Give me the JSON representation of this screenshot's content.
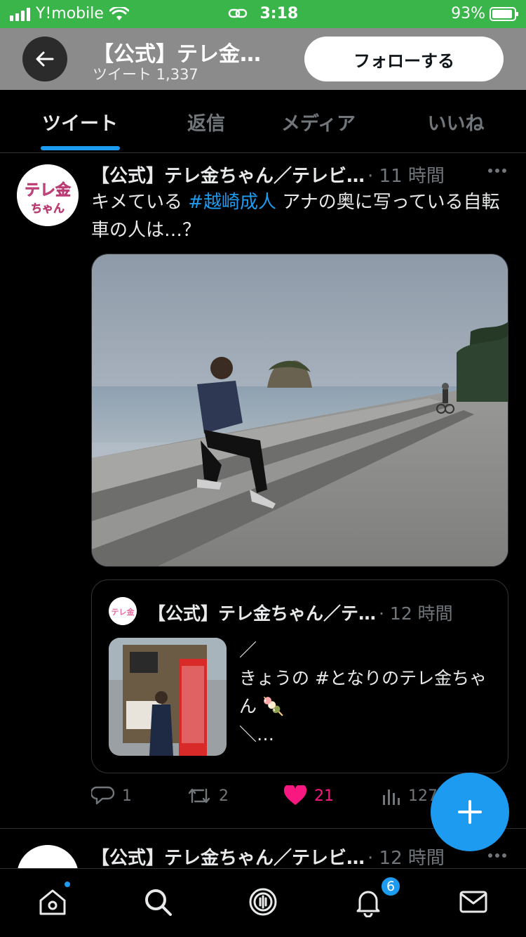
{
  "status_bar": {
    "carrier": "Y!mobile",
    "time": "3:18",
    "battery_percent": "93%",
    "battery_level": 0.93,
    "bg_color": "#3ab54a"
  },
  "header": {
    "title": "【公式】テレ金…",
    "subtitle": "ツイート 1,337",
    "follow_label": "フォローする"
  },
  "tabs": [
    {
      "label": "ツイート",
      "active": true
    },
    {
      "label": "返信",
      "active": false
    },
    {
      "label": "メディア",
      "active": false
    },
    {
      "label": "いいね",
      "active": false
    }
  ],
  "tweet": {
    "author": "【公式】テレ金ちゃん／テレビ…",
    "time": "· 11 時間",
    "text_before": "キメている ",
    "hashtag": "#越崎成人",
    "text_after": " アナの奥に写っている自転車の人は…？",
    "avatar_text_top": "テレ金",
    "avatar_text_bottom": "ちゃん",
    "quote": {
      "author": "【公式】テレ金ちゃん／テ…",
      "time": "· 12 時間",
      "text": "／\nきょうの #となりのテレ金ちゃん 🍡\n＼…",
      "avatar_text": "テレ金"
    },
    "actions": {
      "replies": "1",
      "retweets": "2",
      "likes": "21",
      "views": "127"
    }
  },
  "tweet2": {
    "author": "【公式】テレ金ちゃん／テレビ…",
    "time": "· 12 時間"
  },
  "bottom_nav": {
    "notifications_badge": "6",
    "items": [
      "home-icon",
      "search-icon",
      "spaces-icon",
      "notifications-icon",
      "messages-icon"
    ]
  },
  "colors": {
    "accent": "#1d9bf0",
    "like": "#f91880",
    "muted": "#71767b"
  }
}
